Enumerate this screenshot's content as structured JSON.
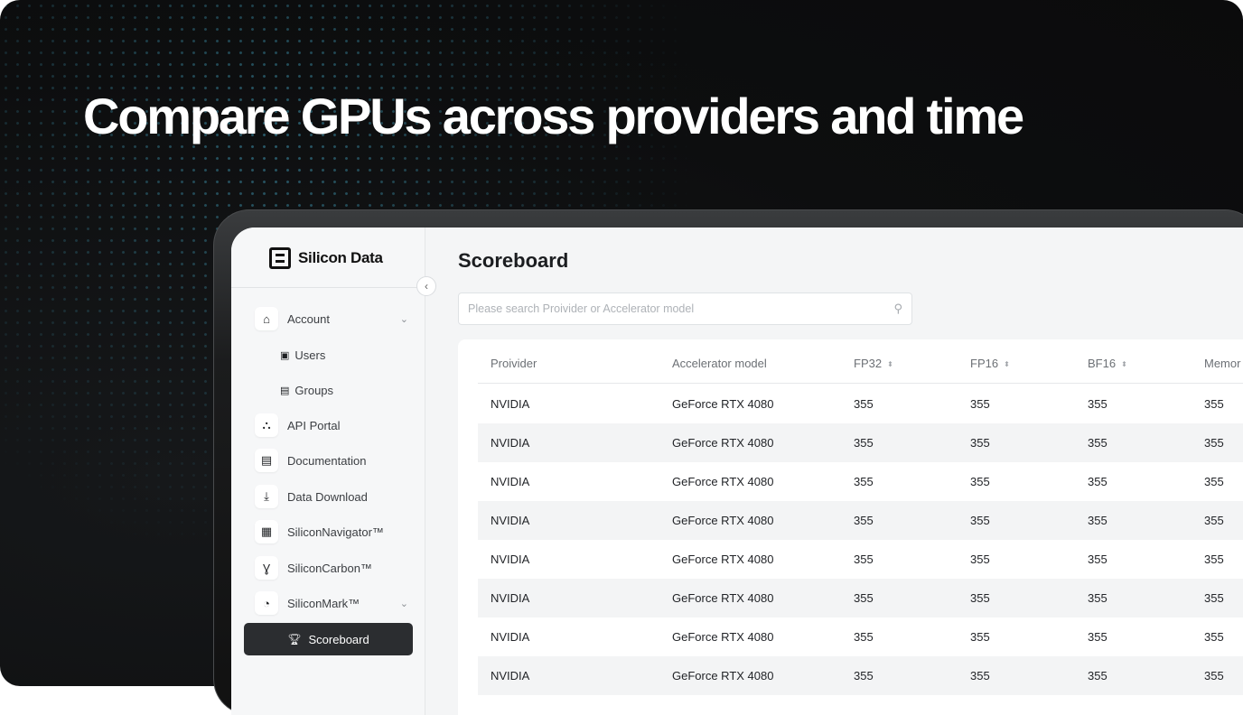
{
  "headline": "Compare GPUs across providers and time",
  "brand": {
    "name": "Silicon Data"
  },
  "sidebar": {
    "collapse_icon": "chevron-left",
    "items": [
      {
        "label": "Account",
        "icon": "home-icon"
      },
      {
        "label": "Users",
        "icon": "user-badge-icon"
      },
      {
        "label": "Groups",
        "icon": "groups-icon"
      },
      {
        "label": "API Portal",
        "icon": "sitemap-icon"
      },
      {
        "label": "Documentation",
        "icon": "document-icon"
      },
      {
        "label": "Data Download",
        "icon": "download-icon"
      },
      {
        "label": "SiliconNavigator™",
        "icon": "chip-icon"
      },
      {
        "label": "SiliconCarbon™",
        "icon": "sprout-icon"
      },
      {
        "label": "SiliconMark™",
        "icon": "gauge-icon"
      },
      {
        "label": "Scoreboard",
        "icon": "trophy-icon",
        "active": true
      }
    ]
  },
  "main": {
    "title": "Scoreboard",
    "search": {
      "placeholder": "Please search Proivider or Accelerator model"
    },
    "table": {
      "columns": [
        "Proivider",
        "Accelerator model",
        "FP32",
        "FP16",
        "BF16",
        "Memor"
      ],
      "rows": [
        [
          "NVIDIA",
          "GeForce RTX 4080",
          "355",
          "355",
          "355",
          "355"
        ],
        [
          "NVIDIA",
          "GeForce RTX 4080",
          "355",
          "355",
          "355",
          "355"
        ],
        [
          "NVIDIA",
          "GeForce RTX 4080",
          "355",
          "355",
          "355",
          "355"
        ],
        [
          "NVIDIA",
          "GeForce RTX 4080",
          "355",
          "355",
          "355",
          "355"
        ],
        [
          "NVIDIA",
          "GeForce RTX 4080",
          "355",
          "355",
          "355",
          "355"
        ],
        [
          "NVIDIA",
          "GeForce RTX 4080",
          "355",
          "355",
          "355",
          "355"
        ],
        [
          "NVIDIA",
          "GeForce RTX 4080",
          "355",
          "355",
          "355",
          "355"
        ],
        [
          "NVIDIA",
          "GeForce RTX 4080",
          "355",
          "355",
          "355",
          "355"
        ]
      ]
    }
  },
  "colors": {
    "background": "#0d0e0f",
    "active_nav": "#2b2d30",
    "dot_accent": "#46aac8"
  }
}
